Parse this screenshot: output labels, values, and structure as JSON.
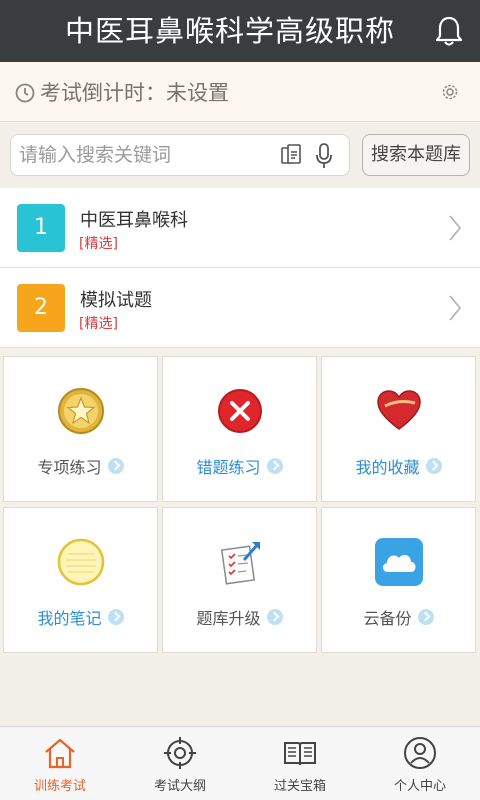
{
  "header": {
    "title": "中医耳鼻喉科学高级职称"
  },
  "countdown": {
    "label": "考试倒计时：未设置"
  },
  "search": {
    "placeholder": "请输入搜索关键词",
    "button_label": "搜索本题库"
  },
  "banks": [
    {
      "number": "1",
      "name": "中医耳鼻喉科",
      "tag": "[精选]",
      "color": "#29c3d6"
    },
    {
      "number": "2",
      "name": "模拟试题",
      "tag": "[精选]",
      "color": "#f7a51b"
    }
  ],
  "features": [
    {
      "label": "专项练习",
      "icon": "star-badge-icon",
      "color": "#555555"
    },
    {
      "label": "错题练习",
      "icon": "red-cross-icon",
      "color": "#2a8fd6"
    },
    {
      "label": "我的收藏",
      "icon": "heart-icon",
      "color": "#2a8fd6"
    },
    {
      "label": "我的笔记",
      "icon": "notepad-icon",
      "color": "#2a8fd6"
    },
    {
      "label": "题库升级",
      "icon": "checklist-upgrade-icon",
      "color": "#555555"
    },
    {
      "label": "云备份",
      "icon": "cloud-icon",
      "color": "#555555"
    }
  ],
  "tabs": [
    {
      "label": "训练考试",
      "icon": "home-icon",
      "active": true
    },
    {
      "label": "考试大纲",
      "icon": "target-icon",
      "active": false
    },
    {
      "label": "过关宝箱",
      "icon": "book-icon",
      "active": false
    },
    {
      "label": "个人中心",
      "icon": "user-icon",
      "active": false
    }
  ],
  "colors": {
    "accent": "#e8632a",
    "link_blue": "#2a8fd6",
    "titlebar": "#3b3c3e"
  }
}
